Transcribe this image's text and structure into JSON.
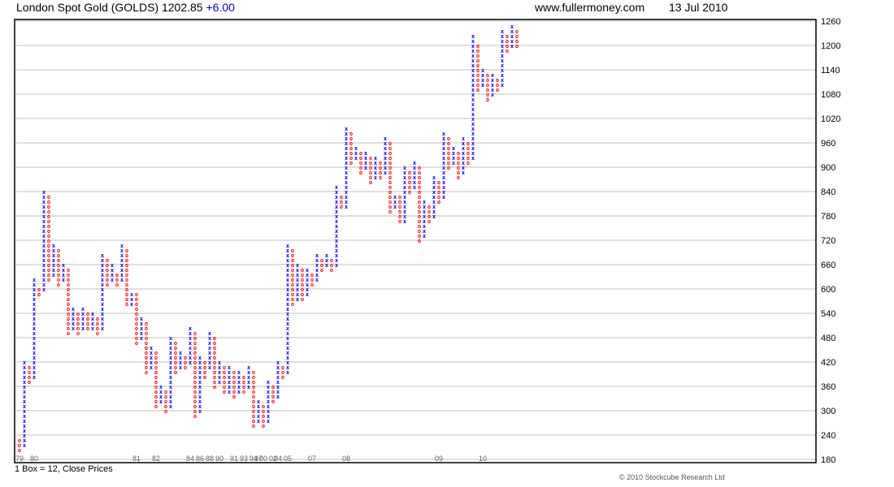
{
  "header": {
    "title": "London Spot Gold (GOLDS) 1202.85",
    "change": "+6.00",
    "site": "www.fullermoney.com",
    "date": "13 Jul 2010"
  },
  "footer": {
    "box_note": "1 Box = 12, Close Prices",
    "copyright": "© 2010 Stockcube Research Ltd"
  },
  "colors": {
    "x": "#0000ff",
    "o": "#ff0000",
    "change": "#0000cc",
    "grid": "#c0c0c0"
  },
  "chart_data": {
    "type": "point-and-figure",
    "box_size": 12,
    "ylim": [
      180,
      1260
    ],
    "yticks": [
      180,
      240,
      300,
      360,
      420,
      480,
      540,
      600,
      660,
      720,
      780,
      840,
      900,
      960,
      1020,
      1080,
      1140,
      1200,
      1260
    ],
    "grid": true,
    "columns": [
      [
        "O",
        228,
        204
      ],
      [
        "X",
        216,
        420
      ],
      [
        "O",
        408,
        372
      ],
      [
        "X",
        384,
        624
      ],
      [
        "O",
        600,
        588
      ],
      [
        "X",
        600,
        840
      ],
      [
        "O",
        828,
        624
      ],
      [
        "X",
        636,
        708
      ],
      [
        "O",
        696,
        612
      ],
      [
        "X",
        624,
        660
      ],
      [
        "O",
        648,
        492
      ],
      [
        "X",
        504,
        552
      ],
      [
        "O",
        540,
        492
      ],
      [
        "X",
        504,
        552
      ],
      [
        "O",
        540,
        504
      ],
      [
        "X",
        504,
        540
      ],
      [
        "O",
        528,
        492
      ],
      [
        "X",
        504,
        684
      ],
      [
        "O",
        672,
        612
      ],
      [
        "X",
        624,
        660
      ],
      [
        "O",
        636,
        612
      ],
      [
        "X",
        624,
        708
      ],
      [
        "O",
        696,
        564
      ],
      [
        "X",
        564,
        588
      ],
      [
        "O",
        588,
        468
      ],
      [
        "X",
        480,
        528
      ],
      [
        "O",
        516,
        396
      ],
      [
        "X",
        408,
        456
      ],
      [
        "O",
        444,
        312
      ],
      [
        "X",
        324,
        360
      ],
      [
        "O",
        348,
        300
      ],
      [
        "X",
        312,
        480
      ],
      [
        "O",
        468,
        396
      ],
      [
        "X",
        408,
        444
      ],
      [
        "O",
        432,
        408
      ],
      [
        "X",
        420,
        504
      ],
      [
        "O",
        492,
        288
      ],
      [
        "X",
        300,
        432
      ],
      [
        "O",
        420,
        384
      ],
      [
        "X",
        408,
        492
      ],
      [
        "O",
        480,
        360
      ],
      [
        "X",
        372,
        420
      ],
      [
        "O",
        408,
        348
      ],
      [
        "X",
        348,
        408
      ],
      [
        "O",
        396,
        336
      ],
      [
        "X",
        348,
        396
      ],
      [
        "O",
        384,
        348
      ],
      [
        "X",
        360,
        408
      ],
      [
        "O",
        396,
        264
      ],
      [
        "X",
        276,
        324
      ],
      [
        "O",
        312,
        264
      ],
      [
        "X",
        276,
        372
      ],
      [
        "O",
        360,
        324
      ],
      [
        "X",
        336,
        420
      ],
      [
        "O",
        408,
        384
      ],
      [
        "X",
        396,
        708
      ],
      [
        "O",
        696,
        564
      ],
      [
        "X",
        576,
        660
      ],
      [
        "O",
        648,
        576
      ],
      [
        "X",
        588,
        648
      ],
      [
        "O",
        636,
        612
      ],
      [
        "X",
        624,
        684
      ],
      [
        "O",
        672,
        648
      ],
      [
        "X",
        660,
        684
      ],
      [
        "O",
        672,
        648
      ],
      [
        "X",
        660,
        852
      ],
      [
        "O",
        828,
        804
      ],
      [
        "X",
        804,
        996
      ],
      [
        "O",
        984,
        912
      ],
      [
        "X",
        924,
        948
      ],
      [
        "O",
        936,
        888
      ],
      [
        "X",
        900,
        936
      ],
      [
        "O",
        924,
        864
      ],
      [
        "X",
        876,
        924
      ],
      [
        "O",
        912,
        876
      ],
      [
        "X",
        888,
        972
      ],
      [
        "O",
        960,
        792
      ],
      [
        "X",
        804,
        828
      ],
      [
        "O",
        828,
        768
      ],
      [
        "X",
        768,
        900
      ],
      [
        "O",
        888,
        840
      ],
      [
        "X",
        852,
        912
      ],
      [
        "O",
        900,
        720
      ],
      [
        "X",
        732,
        816
      ],
      [
        "O",
        804,
        768
      ],
      [
        "X",
        780,
        876
      ],
      [
        "O",
        864,
        816
      ],
      [
        "X",
        828,
        984
      ],
      [
        "O",
        972,
        900
      ],
      [
        "X",
        912,
        948
      ],
      [
        "O",
        936,
        876
      ],
      [
        "X",
        888,
        972
      ],
      [
        "O",
        960,
        912
      ],
      [
        "X",
        924,
        1224
      ],
      [
        "O",
        1200,
        1092
      ],
      [
        "X",
        1104,
        1140
      ],
      [
        "O",
        1128,
        1068
      ],
      [
        "X",
        1080,
        1128
      ],
      [
        "O",
        1116,
        1092
      ],
      [
        "X",
        1104,
        1236
      ],
      [
        "O",
        1224,
        1188
      ],
      [
        "X",
        1200,
        1248
      ],
      [
        "O",
        1236,
        1200
      ]
    ],
    "year_labels": [
      {
        "label": "79",
        "col": 0
      },
      {
        "label": "80",
        "col": 3
      },
      {
        "label": "81",
        "col": 24
      },
      {
        "label": "82",
        "col": 28
      },
      {
        "label": "84",
        "col": 35
      },
      {
        "label": "86",
        "col": 37
      },
      {
        "label": "88",
        "col": 39
      },
      {
        "label": "90",
        "col": 41
      },
      {
        "label": "91",
        "col": 44
      },
      {
        "label": "93",
        "col": 46
      },
      {
        "label": "94",
        "col": 48
      },
      {
        "label": "97",
        "col": 49
      },
      {
        "label": "00",
        "col": 50
      },
      {
        "label": "02",
        "col": 52
      },
      {
        "label": "04",
        "col": 53
      },
      {
        "label": "05",
        "col": 55
      },
      {
        "label": "07",
        "col": 60
      },
      {
        "label": "08",
        "col": 67
      },
      {
        "label": "09",
        "col": 86
      },
      {
        "label": "10",
        "col": 95
      }
    ]
  }
}
